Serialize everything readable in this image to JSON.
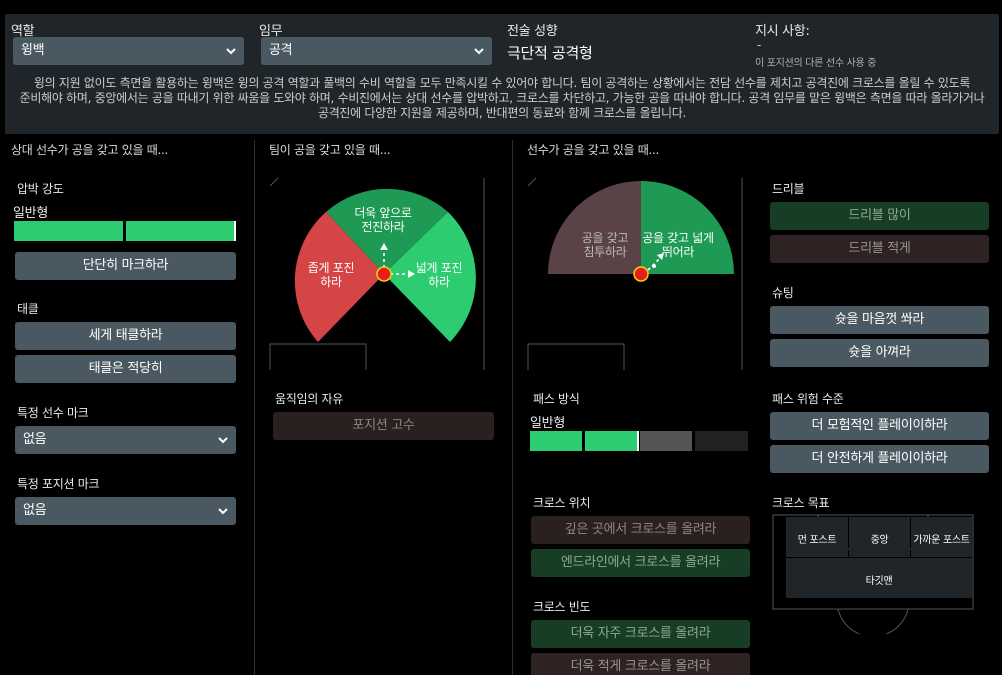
{
  "header": {
    "role_label": "역할",
    "role_value": "윙백",
    "duty_label": "임무",
    "duty_value": "공격",
    "tactic_label": "전술 성향",
    "tactic_value": "극단적 공격형",
    "instruction_label": "지시 사항:",
    "instruction_dash": "-",
    "instruction_note": "이 포지션의 다른 선수 사용 중",
    "description_lines": [
      "윙의 지원 없이도 측면을 활용하는 윙백은 윙의 공격 역할과 풀백의 수비 역할을 모두 만족시킬 수 있어야 합니다. 팀이 공격하는 상황에서는 전담 선수를 제치고 공격진에 크로스를 올릴 수 있도록",
      "준비해야 하며, 중앙에서는 공을 따내기 위한 싸움을 도와야 하며, 수비진에서는 상대 선수를 압박하고, 크로스를 차단하고, 가능한 공을 따내야 합니다. 공격 임무를 맡은 윙백은 측면을 따라 올라가거나",
      "공격진에 다양한 지원을 제공하며, 반대편의 동료와 함께 크로스를 올립니다."
    ]
  },
  "col1": {
    "heading": "상대 선수가 공을 갖고 있을 때...",
    "press_label": "압박 강도",
    "press_value": "일반형",
    "press_level": 0.5,
    "mark_tighter": "단단히 마크하라",
    "tackle_label": "태클",
    "tackle_harder": "세게 태클하라",
    "tackle_ease": "태클은 적당히",
    "mark_player_label": "특정 선수 마크",
    "mark_player_value": "없음",
    "mark_position_label": "특정 포지션 마크",
    "mark_position_value": "없음"
  },
  "col2": {
    "heading": "팀이 공을 갖고 있을 때...",
    "forward": "더욱 앞으로 전진하라",
    "narrow": "좁게 포진하라",
    "wide": "넓게 포진하라",
    "freedom_label": "움직임의 자유",
    "hold_position": "포지션 고수"
  },
  "col3": {
    "heading": "선수가 공을 갖고 있을 때...",
    "cut_inside": "공을 갖고 침투하라",
    "run_wide": "공을 갖고 넓게 뛰어라",
    "passing_label": "패스 방식",
    "passing_value": "일반형",
    "passing_level": 0.5,
    "cross_from_label": "크로스 위치",
    "cross_deep": "깊은 곳에서 크로스를 올려라",
    "cross_byline": "엔드라인에서 크로스를 올려라",
    "cross_freq_label": "크로스 빈도",
    "cross_more": "더욱 자주 크로스를 올려라",
    "cross_less": "더욱 적게 크로스를 올려라"
  },
  "col4": {
    "dribble_label": "드리블",
    "dribble_more": "드리블 많이",
    "dribble_less": "드리블 적게",
    "shoot_label": "슈팅",
    "shoot_more": "슛을 마음껏 쏴라",
    "shoot_less": "슛을 아껴라",
    "risk_label": "패스 위험 수준",
    "risk_more": "더 모험적인 플레이이하라",
    "risk_less": "더 안전하게 플레이이하라",
    "target_label": "크로스 목표",
    "far_post": "먼 포스트",
    "centre": "중앙",
    "near_post": "가까운 포스트",
    "target_man": "타깃맨"
  },
  "colors": {
    "green": "#2ecc71",
    "red": "#d64545",
    "dark_green": "#1e9a55",
    "button_gray": "#4a5961"
  }
}
